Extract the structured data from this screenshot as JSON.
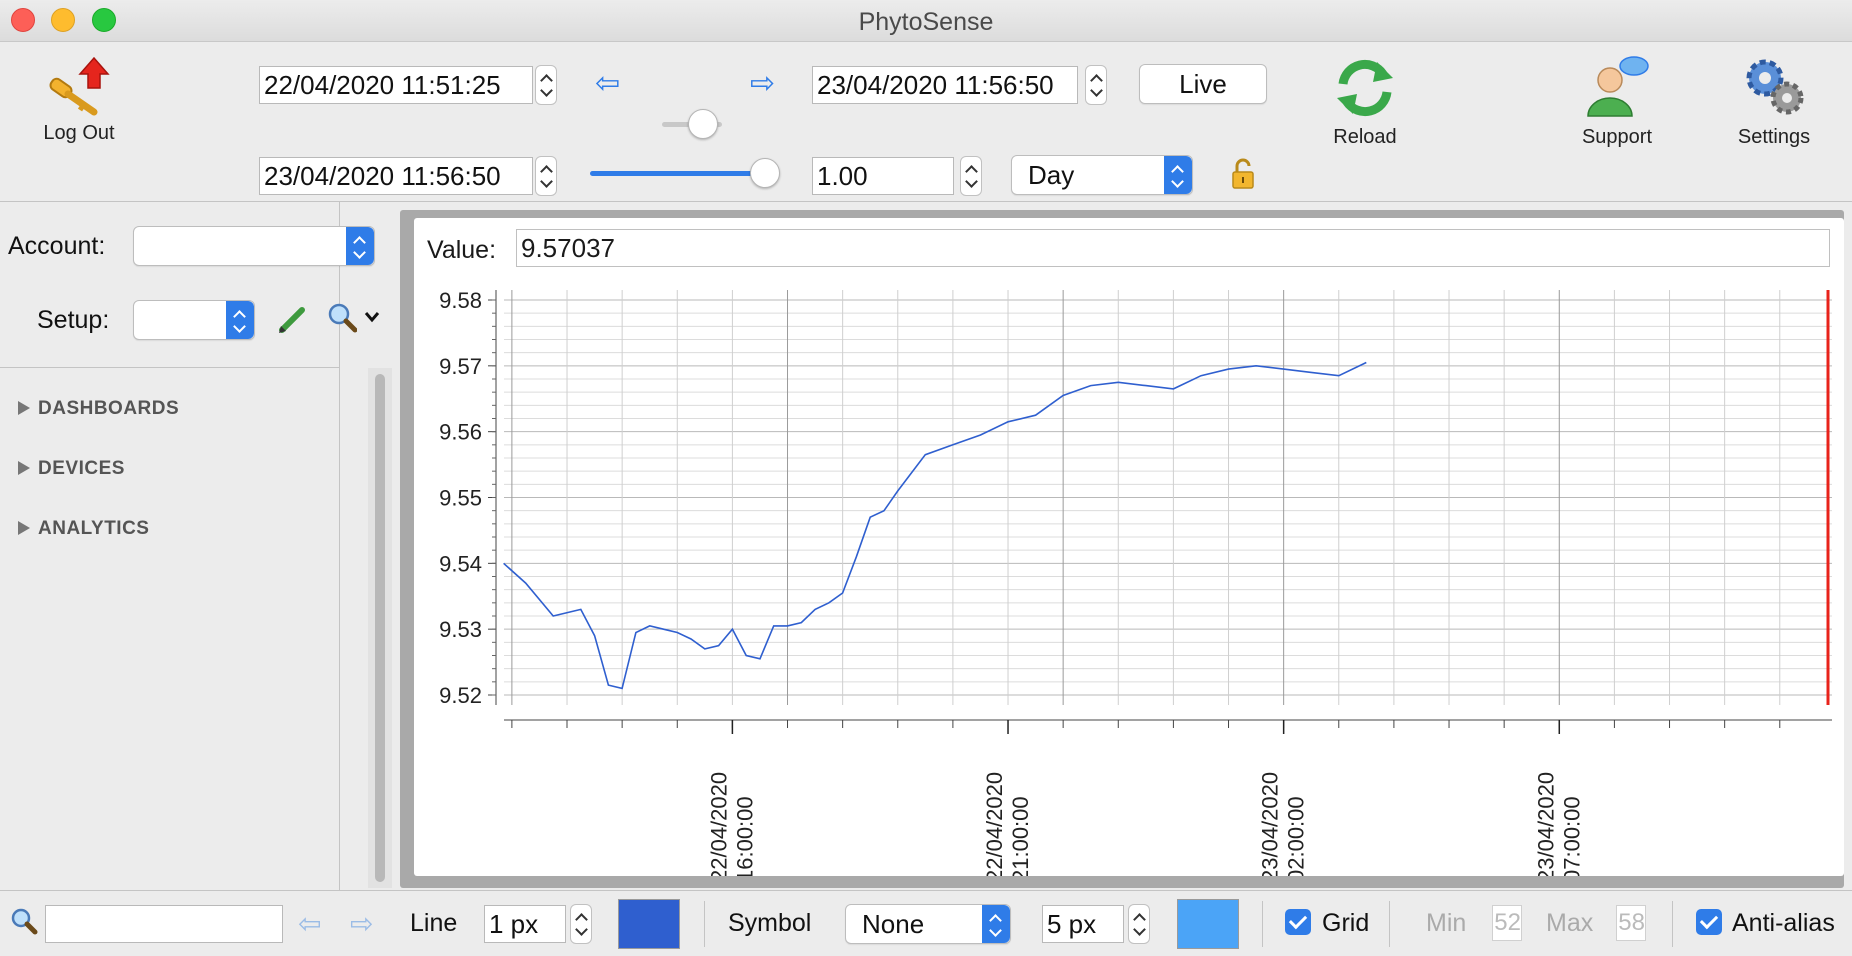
{
  "window": {
    "title": "PhytoSense"
  },
  "toolbar": {
    "logout_label": "Log Out",
    "start_datetime": "22/04/2020 11:51:25",
    "end_datetime": "23/04/2020 11:56:50",
    "cursor_datetime": "23/04/2020 11:56:50",
    "zoom_value": "1.00",
    "period_selected": "Day",
    "live_label": "Live",
    "reload_label": "Reload",
    "support_label": "Support",
    "settings_label": "Settings",
    "cursor_slider_fraction": 1.0,
    "range_slider_fraction": 0.5
  },
  "sidebar": {
    "account_label": "Account:",
    "account_value": "",
    "setup_label": "Setup:",
    "setup_value": "",
    "tree": [
      {
        "label": "DASHBOARDS"
      },
      {
        "label": "DEVICES"
      },
      {
        "label": "ANALYTICS"
      }
    ],
    "search_value": ""
  },
  "value_readout": {
    "label": "Value:",
    "value": "9.57037"
  },
  "chart_data": {
    "type": "line",
    "title": "",
    "xlabel": "",
    "ylabel": "",
    "ylim": [
      9.52,
      9.58
    ],
    "yticks": [
      "9.58",
      "9.57",
      "9.56",
      "9.55",
      "9.54",
      "9.53",
      "9.52"
    ],
    "xlim": [
      "22/04/2020 11:51:25",
      "23/04/2020 11:56:50"
    ],
    "xticks": [
      {
        "date": "22/04/2020",
        "time": "16:00:00"
      },
      {
        "date": "22/04/2020",
        "time": "21:00:00"
      },
      {
        "date": "23/04/2020",
        "time": "02:00:00"
      },
      {
        "date": "23/04/2020",
        "time": "07:00:00"
      }
    ],
    "grid": true,
    "colors": {
      "line": "#2f5fcf",
      "cursor": "#e8231b"
    },
    "series": [
      {
        "x": [
          "22/04/2020 11:51",
          "22/04/2020 12:15",
          "22/04/2020 12:45",
          "22/04/2020 13:15",
          "22/04/2020 13:30",
          "22/04/2020 13:45",
          "22/04/2020 14:00",
          "22/04/2020 14:15",
          "22/04/2020 14:30",
          "22/04/2020 14:45",
          "22/04/2020 15:00",
          "22/04/2020 15:15",
          "22/04/2020 15:30",
          "22/04/2020 15:45",
          "22/04/2020 16:00",
          "22/04/2020 16:15",
          "22/04/2020 16:30",
          "22/04/2020 16:45",
          "22/04/2020 17:00",
          "22/04/2020 17:15",
          "22/04/2020 17:30",
          "22/04/2020 17:45",
          "22/04/2020 18:00",
          "22/04/2020 18:15",
          "22/04/2020 18:30",
          "22/04/2020 18:45",
          "22/04/2020 19:00",
          "22/04/2020 19:30",
          "22/04/2020 20:00",
          "22/04/2020 20:30",
          "22/04/2020 21:00",
          "22/04/2020 21:30",
          "22/04/2020 22:00",
          "22/04/2020 22:30",
          "22/04/2020 23:00",
          "22/04/2020 23:30",
          "23/04/2020 00:00",
          "23/04/2020 00:30",
          "23/04/2020 01:00",
          "23/04/2020 01:30",
          "23/04/2020 02:00",
          "23/04/2020 02:30",
          "23/04/2020 03:00",
          "23/04/2020 03:30"
        ],
        "y": [
          9.54,
          9.537,
          9.532,
          9.533,
          9.529,
          9.5215,
          9.521,
          9.5295,
          9.5305,
          9.53,
          9.5295,
          9.5285,
          9.527,
          9.5275,
          9.53,
          9.526,
          9.5255,
          9.5305,
          9.5305,
          9.531,
          9.533,
          9.534,
          9.5355,
          9.541,
          9.547,
          9.548,
          9.551,
          9.5565,
          9.558,
          9.5595,
          9.5615,
          9.5625,
          9.5655,
          9.567,
          9.5675,
          9.567,
          9.5665,
          9.5685,
          9.5695,
          9.57,
          9.5695,
          9.569,
          9.5685,
          9.5705
        ]
      }
    ]
  },
  "bottombar": {
    "line_label": "Line",
    "line_width": "1 px",
    "line_color": "#2f5fcf",
    "symbol_label": "Symbol",
    "symbol_value": "None",
    "symbol_size": "5 px",
    "symbol_color": "#4ba4f7",
    "grid_label": "Grid",
    "grid_checked": true,
    "min_label": "Min",
    "min_value": "52",
    "max_label": "Max",
    "max_value": "58",
    "antialias_label": "Anti-alias",
    "antialias_checked": true
  }
}
